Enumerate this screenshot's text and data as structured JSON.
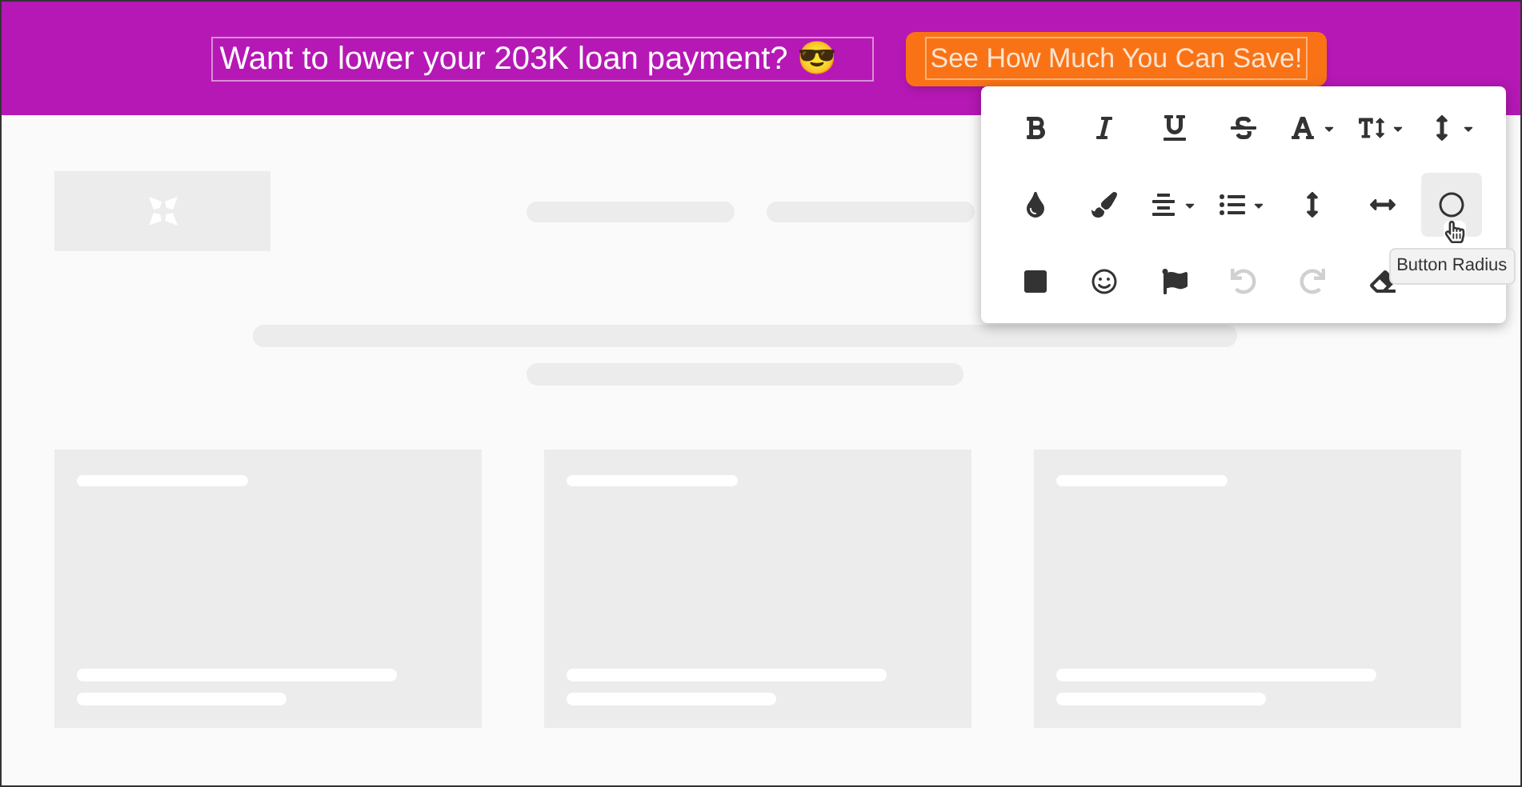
{
  "banner": {
    "message": "Want to lower your 203K loan payment? 😎",
    "cta": "See How Much You Can Save!"
  },
  "toolbar": {
    "tools": [
      {
        "kind": "bold",
        "dropdown": false,
        "disabled": false,
        "selected": false
      },
      {
        "kind": "italic",
        "dropdown": false,
        "disabled": false,
        "selected": false
      },
      {
        "kind": "underline",
        "dropdown": false,
        "disabled": false,
        "selected": false
      },
      {
        "kind": "strikethrough",
        "dropdown": false,
        "disabled": false,
        "selected": false
      },
      {
        "kind": "font",
        "dropdown": true,
        "disabled": false,
        "selected": false
      },
      {
        "kind": "textsize",
        "dropdown": true,
        "disabled": false,
        "selected": false
      },
      {
        "kind": "lineheight",
        "dropdown": true,
        "disabled": false,
        "selected": false
      },
      {
        "kind": "color",
        "dropdown": false,
        "disabled": false,
        "selected": false
      },
      {
        "kind": "brush",
        "dropdown": false,
        "disabled": false,
        "selected": false
      },
      {
        "kind": "align",
        "dropdown": true,
        "disabled": false,
        "selected": false
      },
      {
        "kind": "list",
        "dropdown": true,
        "disabled": false,
        "selected": false
      },
      {
        "kind": "vpadding",
        "dropdown": false,
        "disabled": false,
        "selected": false
      },
      {
        "kind": "hpadding",
        "dropdown": false,
        "disabled": false,
        "selected": false
      },
      {
        "kind": "radius",
        "dropdown": false,
        "disabled": false,
        "selected": true,
        "tooltip": "Button Radius"
      },
      {
        "kind": "background",
        "dropdown": false,
        "disabled": false,
        "selected": false
      },
      {
        "kind": "emoji",
        "dropdown": false,
        "disabled": false,
        "selected": false
      },
      {
        "kind": "flag",
        "dropdown": false,
        "disabled": false,
        "selected": false
      },
      {
        "kind": "undo",
        "dropdown": false,
        "disabled": true,
        "selected": false
      },
      {
        "kind": "redo",
        "dropdown": false,
        "disabled": true,
        "selected": false
      },
      {
        "kind": "eraser",
        "dropdown": false,
        "disabled": false,
        "selected": false
      }
    ]
  }
}
